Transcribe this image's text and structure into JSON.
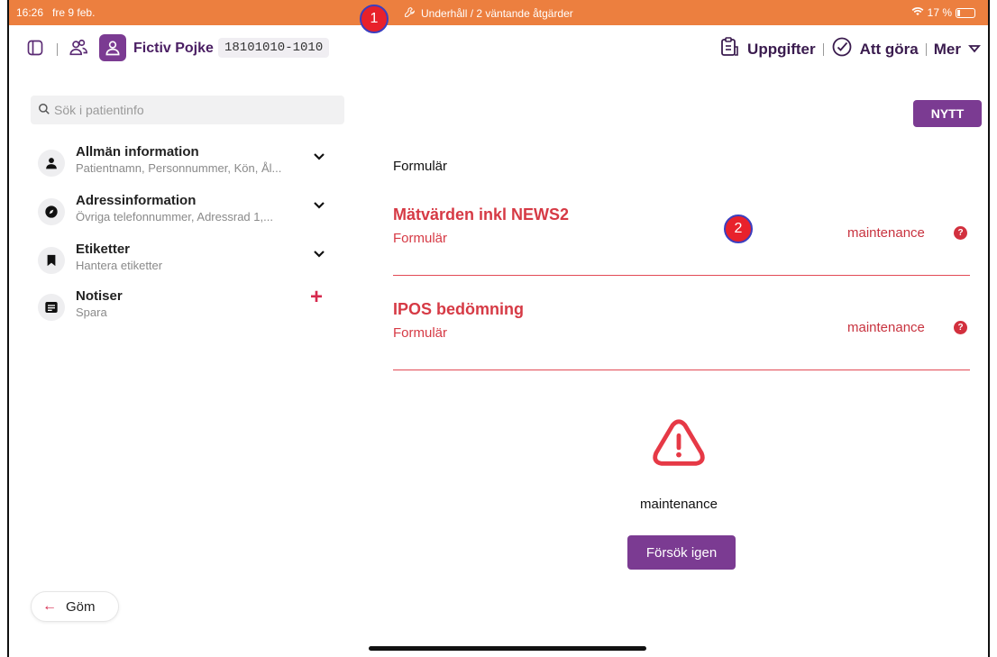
{
  "status_bar": {
    "time": "16:26",
    "date": "fre 9 feb.",
    "maintenance_text": "Underhåll / 2 väntande åtgärder",
    "battery": "17 %",
    "background_color": "#ec7f3f"
  },
  "header": {
    "patient_name": "Fictiv Pojke",
    "patient_id": "18101010-1010",
    "tasks_label": "Uppgifter",
    "todo_label": "Att göra",
    "more_label": "Mer"
  },
  "sidebar": {
    "search_placeholder": "Sök i patientinfo",
    "items": [
      {
        "title": "Allmän information",
        "subtitle": "Patientnamn, Personnummer, Kön, Ål...",
        "icon": "person-icon",
        "action": "expand"
      },
      {
        "title": "Adressinformation",
        "subtitle": "Övriga telefonnummer, Adressrad 1,...",
        "icon": "compass-icon",
        "action": "expand"
      },
      {
        "title": "Etiketter",
        "subtitle": "Hantera etiketter",
        "icon": "bookmark-icon",
        "action": "expand"
      },
      {
        "title": "Notiser",
        "subtitle": "Spara",
        "icon": "note-icon",
        "action": "add"
      }
    ],
    "hide_label": "Göm"
  },
  "main": {
    "new_button": "NYTT",
    "section_title": "Formulär",
    "forms": [
      {
        "title": "Mätvärden inkl NEWS2",
        "subtitle": "Formulär",
        "status": "maintenance"
      },
      {
        "title": "IPOS bedömning",
        "subtitle": "Formulär",
        "status": "maintenance"
      }
    ],
    "error_text": "maintenance",
    "retry_label": "Försök igen"
  },
  "annotations": [
    "1",
    "2"
  ],
  "colors": {
    "brand_purple": "#7b3b92",
    "error_red": "#d63a45",
    "status_orange": "#ec7f3f"
  }
}
